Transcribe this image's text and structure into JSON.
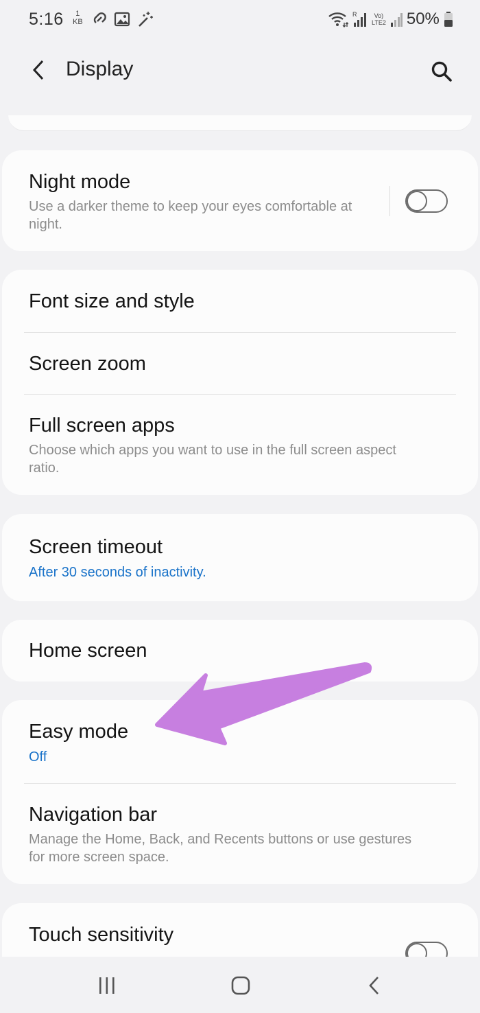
{
  "status_bar": {
    "time": "5:16",
    "data_amount": "1",
    "data_unit": "KB",
    "battery": "50%",
    "network_lines": [
      "Vo)",
      "LTE2"
    ],
    "icons": [
      "link-icon",
      "image-icon",
      "magic-wand-icon",
      "wifi-icon",
      "signal-icon",
      "battery-icon"
    ]
  },
  "header": {
    "title": "Display",
    "back_icon": "back-arrow-icon",
    "search_icon": "search-icon"
  },
  "settings": {
    "night_mode": {
      "title": "Night mode",
      "subtitle": "Use a darker theme to keep your eyes comfortable at night.",
      "enabled": false
    },
    "font_size": {
      "title": "Font size and style"
    },
    "screen_zoom": {
      "title": "Screen zoom"
    },
    "full_screen_apps": {
      "title": "Full screen apps",
      "subtitle": "Choose which apps you want to use in the full screen aspect ratio."
    },
    "screen_timeout": {
      "title": "Screen timeout",
      "subtitle": "After 30 seconds of inactivity."
    },
    "home_screen": {
      "title": "Home screen"
    },
    "easy_mode": {
      "title": "Easy mode",
      "subtitle": "Off"
    },
    "navigation_bar": {
      "title": "Navigation bar",
      "subtitle": "Manage the Home, Back, and Recents buttons or use gestures for more screen space."
    },
    "touch_sensitivity": {
      "title": "Touch sensitivity",
      "enabled": false
    }
  },
  "colors": {
    "accent": "#1a73c9",
    "annotation_arrow": "#c77fe0",
    "background": "#f2f2f4",
    "card": "#fcfcfc"
  },
  "nav_bar": {
    "icons": [
      "recents-icon",
      "home-icon",
      "back-icon"
    ]
  }
}
